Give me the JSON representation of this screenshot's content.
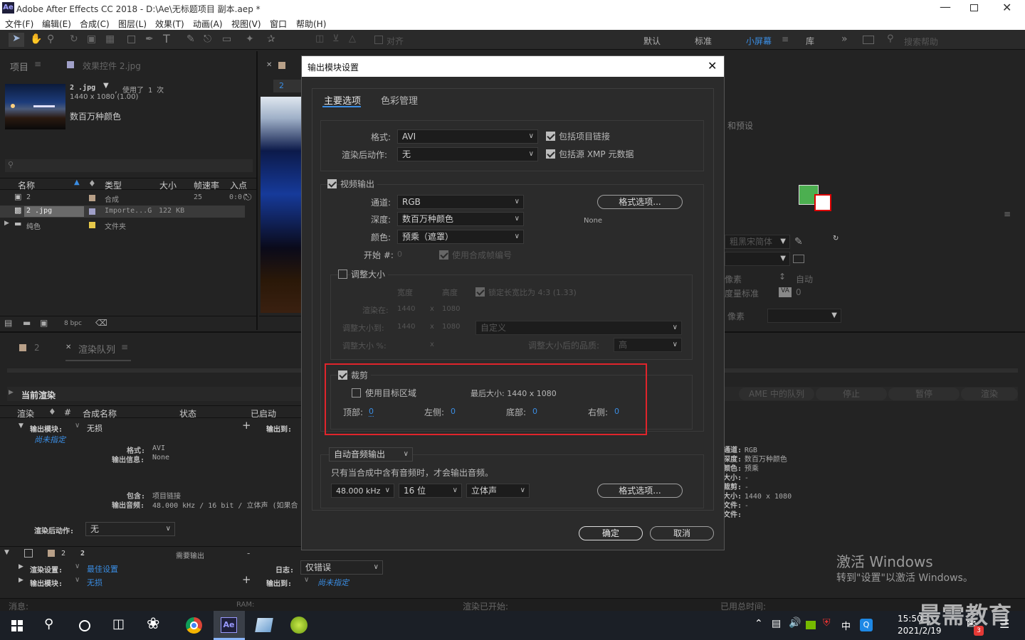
{
  "window": {
    "app_badge": "Ae",
    "title": "Adobe After Effects CC 2018 - D:\\Ae\\无标题项目 副本.aep *"
  },
  "menu": [
    "文件(F)",
    "编辑(E)",
    "合成(C)",
    "图层(L)",
    "效果(T)",
    "动画(A)",
    "视图(V)",
    "窗口",
    "帮助(H)"
  ],
  "toolbar": {
    "align_label": "对齐",
    "workspaces": [
      "默认",
      "标准",
      "小屏幕",
      "库"
    ],
    "active_workspace": "小屏幕",
    "search_placeholder": "搜索帮助"
  },
  "project_panel": {
    "tab_label": "项目",
    "effects_tab": "效果控件 2.jpg",
    "asset_name": "2 .jpg",
    "asset_usage": ", 使用了 1 次",
    "asset_dims": "1440 x 1080 (1.00)",
    "asset_color": "数百万种颜色",
    "search_placeholder": "",
    "columns": [
      "名称",
      "类型",
      "大小",
      "帧速率",
      "入点"
    ],
    "rows": [
      {
        "name": "2",
        "type": "合成",
        "size": "",
        "fps": "25",
        "in": "0:0("
      },
      {
        "name": "2 .jpg",
        "type": "Importe...G",
        "size": "122 KB",
        "fps": "",
        "in": ""
      },
      {
        "name": "纯色",
        "type": "文件夹",
        "size": "",
        "fps": "",
        "in": ""
      }
    ],
    "bpc": "8 bpc"
  },
  "comp_panel": {
    "tab_number": "2"
  },
  "render_panel": {
    "tab_comp": "2",
    "tab_label": "渲染队列",
    "current_render": "当前渲染",
    "buttons": [
      "AME 中的队列",
      "停止",
      "暂停",
      "渲染"
    ],
    "columns": [
      "渲染",
      "#",
      "合成名称",
      "状态",
      "已启动"
    ],
    "output_module_label": "输出模块:",
    "output_module_value": "无损",
    "output_to_label": "输出到:",
    "unspecified": "尚未指定",
    "format_label": "格式:",
    "format_value": "AVI",
    "output_info_label": "输出信息:",
    "output_info_value": "None",
    "include_label": "包含:",
    "include_value": "项目链接",
    "output_audio_label": "输出音频:",
    "output_audio_value": "48.000 kHz / 16 bit / 立体声 (如果合",
    "post_render_label": "渲染后动作:",
    "post_render_value": "无",
    "queue_row": {
      "num": "2",
      "name": "2",
      "status": "需要输出",
      "started": "-"
    },
    "render_settings_label": "渲染设置:",
    "render_settings_value": "最佳设置",
    "log_label": "日志:",
    "log_value": "仅错误",
    "output_module2_value": "无损",
    "output_to2_value": "尚未指定",
    "right_info": [
      {
        "label": "通道:",
        "value": "RGB"
      },
      {
        "label": "深度:",
        "value": "数百万种颜色"
      },
      {
        "label": "颜色:",
        "value": "预乘"
      },
      {
        "label": "大小:",
        "value": "-"
      },
      {
        "label": "裁剪:",
        "value": "-"
      },
      {
        "label": "大小:",
        "value": "1440 x 1080"
      },
      {
        "label": "文件:",
        "value": "-"
      },
      {
        "label": "文件:",
        "value": ""
      }
    ]
  },
  "right_panel": {
    "presets_label": "和预设",
    "font_name": "粗黑宋简体",
    "leading": "自动",
    "px_label": "像素",
    "metrics": "度量标准",
    "va_value": "0",
    "px2": "像素"
  },
  "status_bar": {
    "message": "消息:",
    "ram": "RAM:",
    "render_started": "渲染已开始:",
    "total_time": "已用总时间:"
  },
  "watermark": {
    "line1": "激活 Windows",
    "line2": "转到\"设置\"以激活 Windows。",
    "logo": "最需教育"
  },
  "taskbar": {
    "time": "15:50",
    "date": "2021/2/19",
    "ime": "中",
    "notify_count": "3",
    "ae_badge": "Ae"
  },
  "dialog": {
    "title": "输出模块设置",
    "tabs": [
      "主要选项",
      "色彩管理"
    ],
    "format_label": "格式:",
    "format_value": "AVI",
    "post_render_label": "渲染后动作:",
    "post_render_value": "无",
    "include_project_link": "包括项目链接",
    "include_xmp": "包括源 XMP 元数据",
    "video_output": "视频输出",
    "channel_label": "通道:",
    "channel_value": "RGB",
    "depth_label": "深度:",
    "depth_value": "数百万种颜色",
    "color_label": "颜色:",
    "color_value": "预乘（遮罩）",
    "start_label": "开始 #:",
    "start_value": "0",
    "use_comp_frame": "使用合成帧编号",
    "format_options": "格式选项...",
    "codec_value": "None",
    "resize": "调整大小",
    "width": "宽度",
    "height": "高度",
    "lock_aspect": "锁定长宽比为 4:3 (1.33)",
    "render_at_label": "渲染在:",
    "render_w": "1440",
    "x": "x",
    "render_h": "1080",
    "resize_to_label": "调整大小到:",
    "resize_w": "1440",
    "resize_h": "1080",
    "custom": "自定义",
    "resize_pct_label": "调整大小 %:",
    "quality_label": "调整大小后的品质:",
    "quality_value": "高",
    "crop": "裁剪",
    "use_roi": "使用目标区域",
    "final_size": "最后大小: 1440 x 1080",
    "top_label": "顶部:",
    "top_value": "0",
    "left_label": "左侧:",
    "left_value": "0",
    "bottom_label": "底部:",
    "bottom_value": "0",
    "right_label": "右侧:",
    "right_value": "0",
    "audio_mode": "自动音频输出",
    "audio_note": "只有当合成中含有音频时，才会输出音频。",
    "sample_rate": "48.000 kHz",
    "bit_depth": "16 位",
    "channels": "立体声",
    "audio_format_options": "格式选项...",
    "ok": "确定",
    "cancel": "取消"
  },
  "colors": {
    "highlight_box": "#e0242b",
    "link_blue": "#3a8de3",
    "workspace_active": "#3a8de3"
  }
}
